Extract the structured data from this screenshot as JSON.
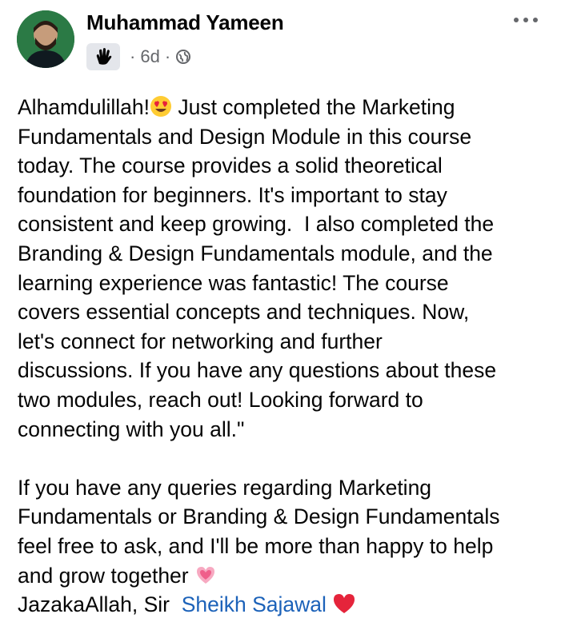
{
  "post": {
    "author": "Muhammad Yameen",
    "time": "6d",
    "separator": "·",
    "audience_icon": "globe-icon",
    "badge_icon": "waving-hand-icon",
    "more_icon": "more-options-icon",
    "paragraph1_start": "Alhamdulillah!",
    "paragraph1_rest": " Just completed the Marketing\nFundamentals and Design Module in this course\ntoday. The course provides a solid theoretical\nfoundation for beginners. It's important to stay\nconsistent and keep growing.  I also completed the\nBranding & Design Fundamentals module, and the\nlearning experience was fantastic! The course\ncovers essential concepts and techniques. Now,\nlet's connect for networking and further\ndiscussions. If you have any questions about these\ntwo modules, reach out! Looking forward to\nconnecting with you all.\"\n\n",
    "paragraph2": "If you have any queries regarding Marketing\nFundamentals or Branding & Design Fundamentals\nfeel free to ask, and I'll be more than happy to help\nand grow together ",
    "closing_prefix": "\nJazakaAllah, Sir  ",
    "mention": "Sheikh Sajawal",
    "closing_suffix": " ",
    "emojis": [
      "heart-eyes-emoji",
      "sparkling-heart-emoji",
      "red-heart-emoji"
    ],
    "colors": {
      "link": "#1c62b9",
      "meta": "#65676b",
      "text": "#050505"
    }
  }
}
